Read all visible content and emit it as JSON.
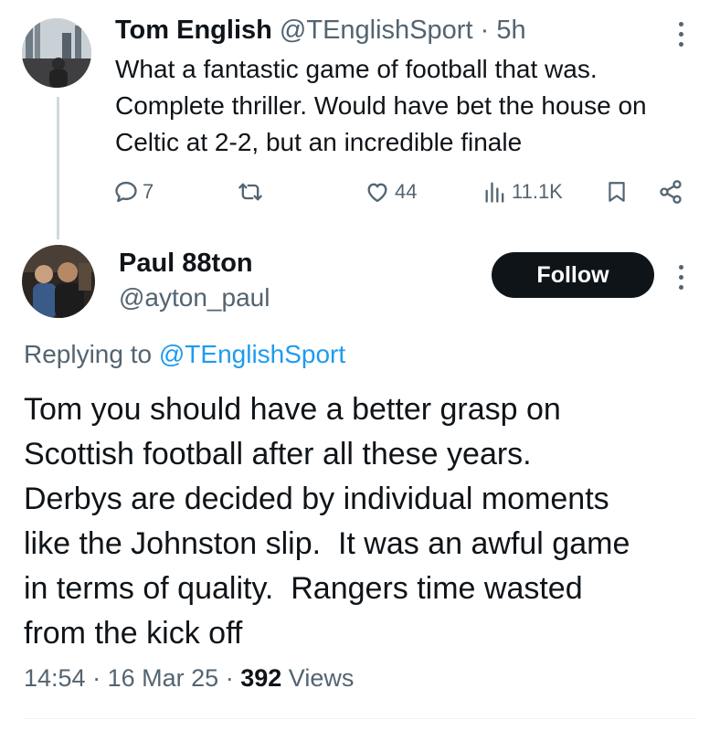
{
  "tweet1": {
    "author_name": "Tom English",
    "author_handle": "@TEnglishSport",
    "separator": "·",
    "time_ago": "5h",
    "text_lines": [
      "What a fantastic game of football that was.",
      "Complete thriller. Would have bet the house on",
      "Celtic at 2-2, but an incredible finale"
    ],
    "replies": "7",
    "likes": "44",
    "views": "11.1K",
    "icons": {
      "reply": "reply-icon",
      "retweet": "retweet-icon",
      "like": "heart-icon",
      "views": "views-icon",
      "bookmark": "bookmark-icon",
      "share": "share-icon",
      "more": "more-icon"
    }
  },
  "tweet2": {
    "author_name": "Paul 88ton",
    "author_handle": "@ayton_paul",
    "follow_label": "Follow",
    "replying_prefix": "Replying to",
    "replying_handle": "@TEnglishSport",
    "text_lines": [
      "Tom you should have a better grasp on",
      "Scottish football after all these years.",
      "Derbys are decided by individual moments",
      "like the Johnston slip.  It was an awful game",
      "in terms of quality.  Rangers time wasted",
      "from the kick off"
    ],
    "time": "14:54",
    "date": "16 Mar 25",
    "separator": "·",
    "views_count": "392",
    "views_label": "Views"
  },
  "colors": {
    "text": "#0f1419",
    "secondary": "#536471",
    "link": "#1d9bf0",
    "follow_bg": "#0f1419",
    "divider": "#eff3f4"
  }
}
